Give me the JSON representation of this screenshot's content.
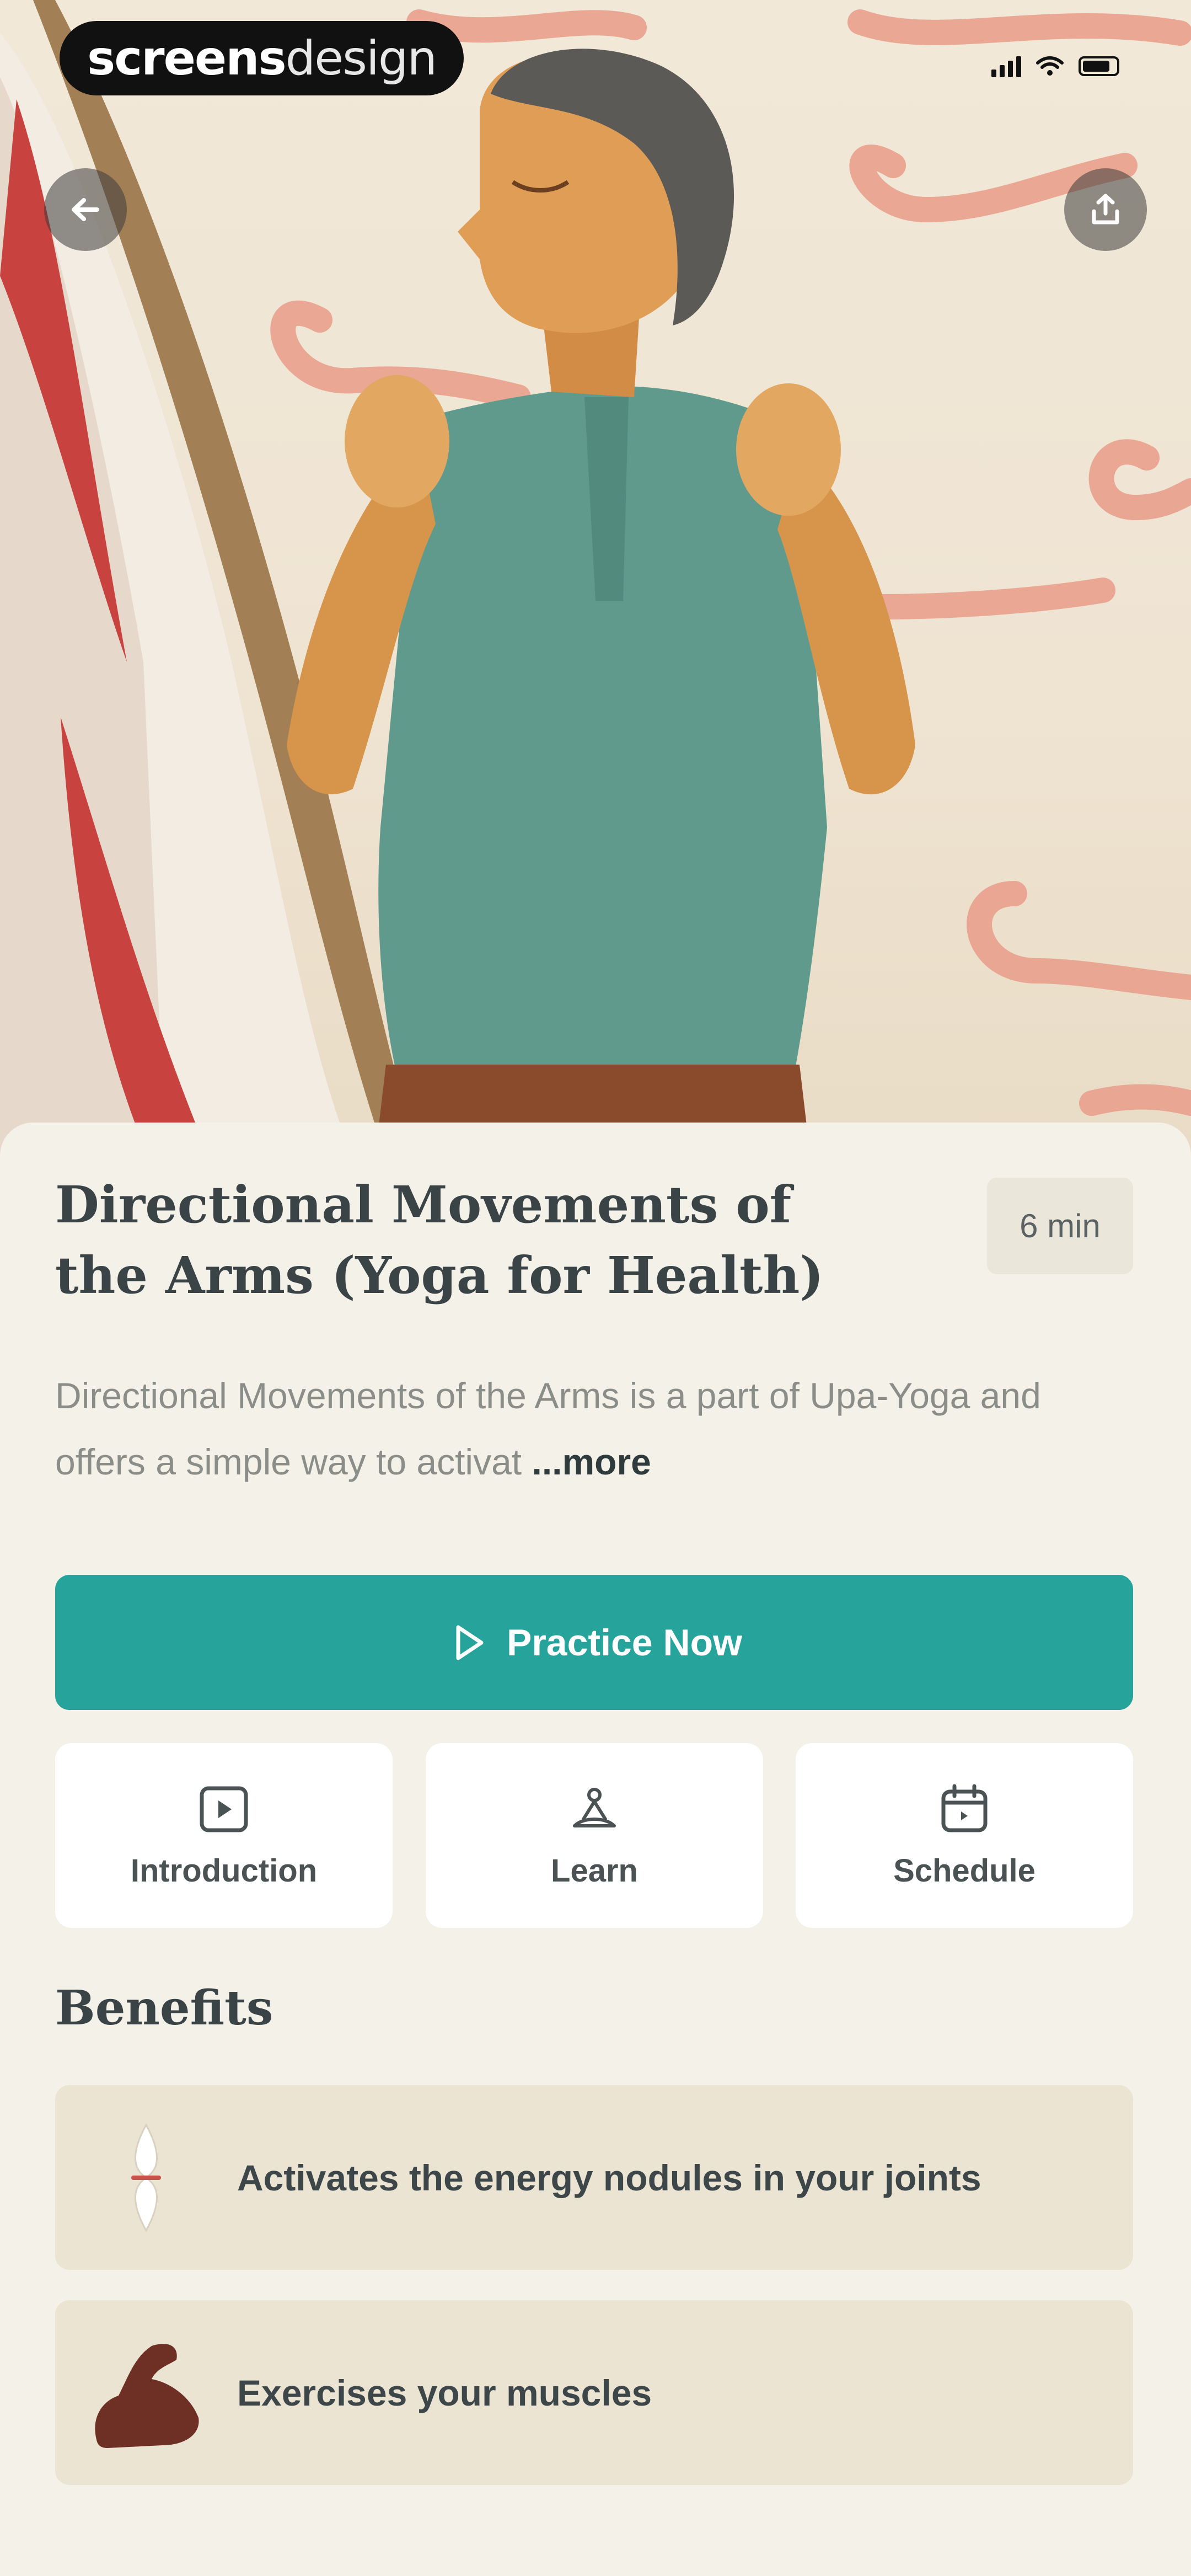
{
  "watermark": {
    "bold": "screens",
    "light": "design"
  },
  "hero": {
    "back_icon": "arrow-left-icon",
    "share_icon": "share-icon"
  },
  "session": {
    "title": "Directional Movements of the Arms (Yoga for Health)",
    "duration": "6 min",
    "description": "Directional Movements of the Arms is a part of Upa-Yoga and offers a simple way to activat",
    "more_label": "...more"
  },
  "actions": {
    "practice_label": "Practice Now",
    "options": [
      {
        "label": "Introduction",
        "icon": "play-square-icon"
      },
      {
        "label": "Learn",
        "icon": "meditation-icon"
      },
      {
        "label": "Schedule",
        "icon": "calendar-icon"
      }
    ]
  },
  "benefits": {
    "heading": "Benefits",
    "items": [
      {
        "text": "Activates the energy nodules in your joints",
        "icon": "joint-icon"
      },
      {
        "text": "Exercises your muscles",
        "icon": "muscle-icon"
      }
    ]
  },
  "colors": {
    "accent": "#26a39a",
    "sheet": "#f4f1e9",
    "benefit_card": "#ebe4d3"
  }
}
